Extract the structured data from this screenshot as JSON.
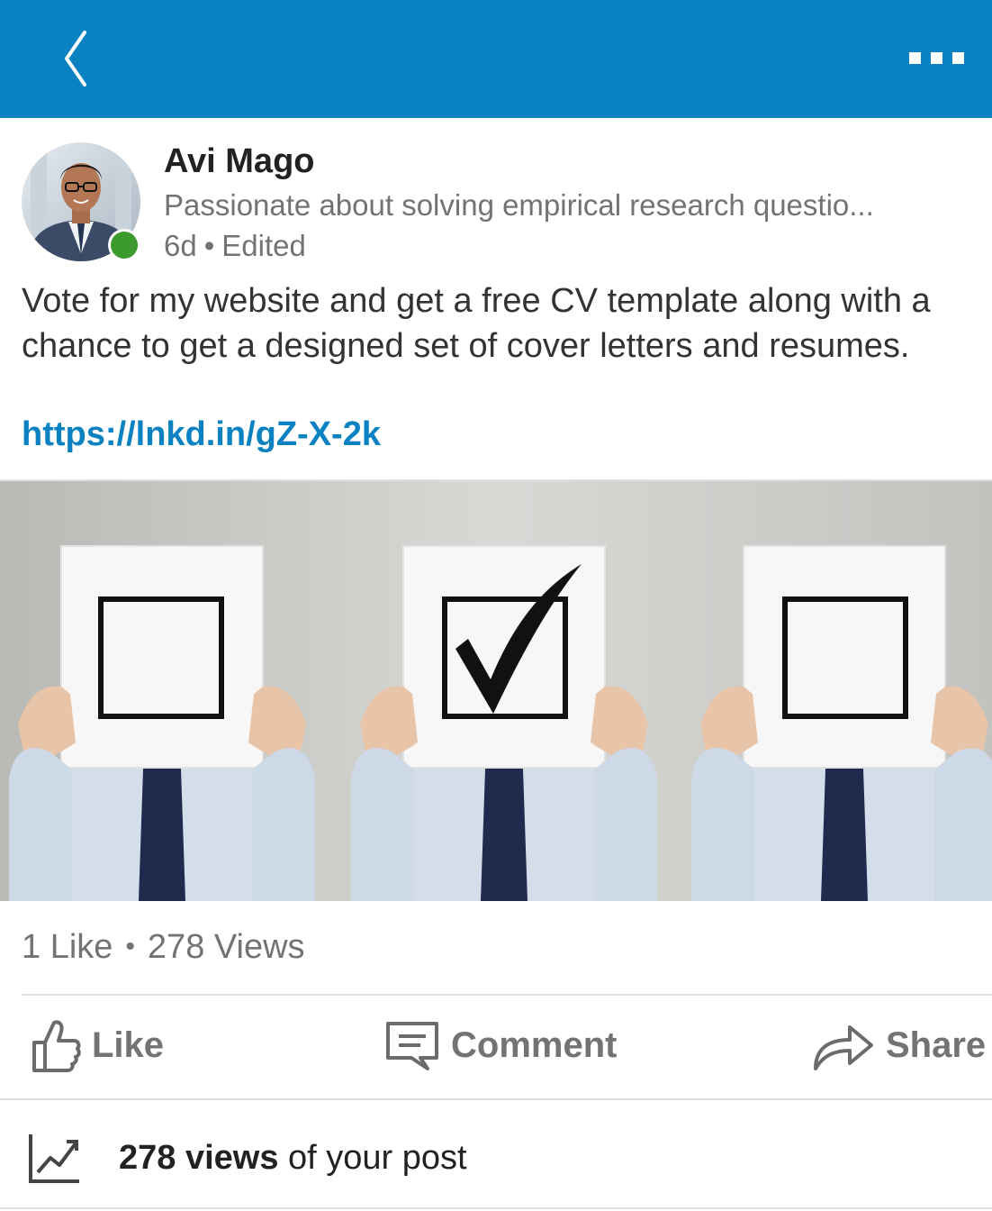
{
  "header": {
    "back_icon": "chevron-left-icon",
    "more_icon": "more-horizontal-icon",
    "bar_color": "#0a82c2"
  },
  "post": {
    "author": {
      "name": "Avi Mago",
      "headline": "Passionate about solving empirical research questio...",
      "online": true,
      "online_color": "#3a9a2b"
    },
    "time": "6d",
    "edited": "Edited",
    "text": "Vote for my website and get a free CV template along with a chance to get a designed set of cover letters and resumes.",
    "link": "https://lnkd.in/gZ-X-2k",
    "image_description": "three businessmen holding checkbox signs, the middle one checked"
  },
  "social": {
    "likes": "1 Like",
    "views": "278 Views"
  },
  "actions": [
    {
      "label": "Like",
      "icon": "thumbs-up-icon"
    },
    {
      "label": "Comment",
      "icon": "comment-icon"
    },
    {
      "label": "Share",
      "icon": "share-arrow-icon"
    }
  ],
  "analytics": {
    "icon": "trend-chart-icon",
    "views_bold": "278 views",
    "suffix": " of your post"
  },
  "colors": {
    "link": "#0a82c2",
    "muted": "#737373"
  }
}
